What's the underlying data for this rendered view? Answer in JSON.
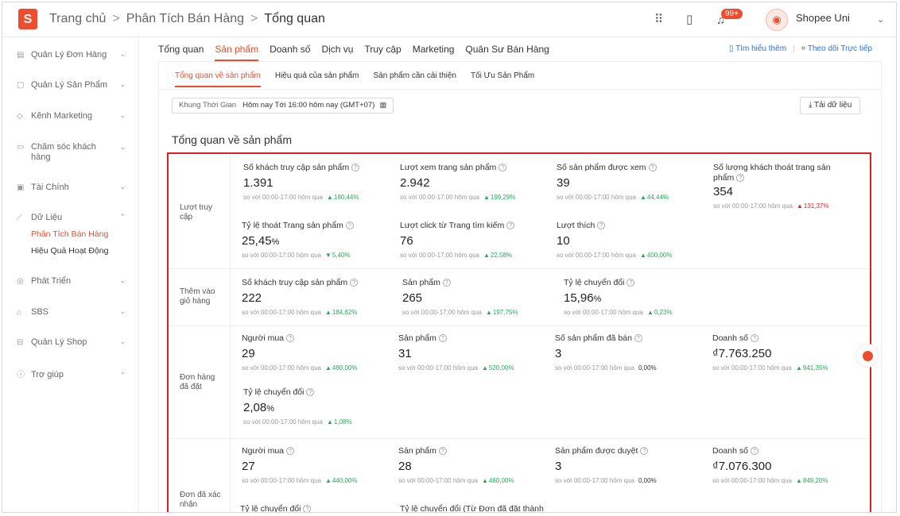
{
  "header": {
    "logo_glyph": "S",
    "breadcrumb": [
      "Trang chủ",
      "Phân Tích Bán Hàng",
      "Tổng quan"
    ],
    "breadcrumb_sep": ">",
    "notif_badge": "99+",
    "shop_name": "Shopee Uni",
    "icons": [
      "apps-grid-icon",
      "book-icon",
      "bell-icon",
      "chevron-down-icon"
    ]
  },
  "sidebar": {
    "items": [
      {
        "label": "Quản Lý Đơn Hàng",
        "icon": "order-icon"
      },
      {
        "label": "Quản Lý Sản Phẩm",
        "icon": "product-icon"
      },
      {
        "label": "Kênh Marketing",
        "icon": "tag-icon"
      },
      {
        "label": "Chăm sóc khách hàng",
        "icon": "chat-icon"
      },
      {
        "label": "Tài Chính",
        "icon": "wallet-icon"
      },
      {
        "label": "Dữ Liệu",
        "icon": "chart-icon"
      },
      {
        "label": "Phát Triển",
        "icon": "growth-icon"
      },
      {
        "label": "SBS",
        "icon": "warehouse-icon"
      },
      {
        "label": "Quản Lý Shop",
        "icon": "shop-icon"
      },
      {
        "label": "Trợ giúp",
        "icon": "help-icon"
      }
    ],
    "sub_items": [
      "Phân Tích Bán Hàng",
      "Hiệu Quả Hoạt Động"
    ]
  },
  "main_tabs": [
    "Tổng quan",
    "Sản phẩm",
    "Doanh số",
    "Dịch vụ",
    "Truy cập",
    "Marketing",
    "Quân Sư Bán Hàng"
  ],
  "top_links": {
    "learn_more": "Tìm hiểu thêm",
    "live_track": "Theo dõi Trực tiếp"
  },
  "sub_tabs": [
    "Tổng quan về sản phẩm",
    "Hiệu quả của sản phẩm",
    "Sản phẩm cần cải thiện",
    "Tối Ưu Sản Phẩm"
  ],
  "period": {
    "label": "Khung Thời Gian",
    "value": "Hôm nay  Tới 16:00 hôm nay (GMT+07)"
  },
  "download_label": "Tải dữ liệu",
  "section_title": "Tổng quan về sản phẩm",
  "compare_text": "so với 00:00-17:00 hôm qua",
  "rows": {
    "traffic": "Lượt truy cập",
    "add_to_cart": "Thêm vào giỏ hàng",
    "placed": "Đơn hàng đã đặt",
    "confirmed": "Đơn đã xác nhận"
  },
  "metrics": {
    "visitors": {
      "label": "Số khách truy cập sản phẩm",
      "value": "1.391",
      "delta": "180,44%"
    },
    "page_views": {
      "label": "Lượt xem trang sản phẩm",
      "value": "2.942",
      "delta": "199,29%"
    },
    "viewed_products": {
      "label": "Số sản phẩm được xem",
      "value": "39",
      "delta": "44,44%"
    },
    "bounce_visitors": {
      "label": "Số lượng khách thoát trang sản phẩm",
      "value": "354",
      "delta": "131,37%"
    },
    "bounce_rate": {
      "label": "Tỷ lệ thoát Trang sản phẩm",
      "value": "25,45",
      "unit": "%",
      "delta": "5,40%"
    },
    "search_clicks": {
      "label": "Lượt click từ Trang tìm kiếm",
      "value": "76",
      "delta": "22,58%"
    },
    "likes": {
      "label": "Lượt thích",
      "value": "10",
      "delta": "400,00%"
    },
    "cart_visitors": {
      "label": "Số khách truy cập sản phẩm",
      "value": "222",
      "delta": "184,62%"
    },
    "cart_products": {
      "label": "Sản phẩm",
      "value": "265",
      "delta": "197,75%"
    },
    "cart_conversion": {
      "label": "Tỷ lệ chuyển đổi",
      "value": "15,96",
      "unit": "%",
      "delta": "0,23%"
    },
    "placed_buyers": {
      "label": "Người mua",
      "value": "29",
      "delta": "480,00%"
    },
    "placed_products": {
      "label": "Sản phẩm",
      "value": "31",
      "delta": "520,00%"
    },
    "placed_units": {
      "label": "Số sản phẩm đã bán",
      "value": "3",
      "delta": "0,00%"
    },
    "placed_sales": {
      "label": "Doanh số",
      "value": "₫7.763.250",
      "delta": "941,35%"
    },
    "placed_conversion": {
      "label": "Tỷ lệ chuyển đổi",
      "value": "2,08",
      "unit": "%",
      "delta": "1,08%"
    },
    "conf_buyers": {
      "label": "Người mua",
      "value": "27",
      "delta": "440,00%"
    },
    "conf_products": {
      "label": "Sản phẩm",
      "value": "28",
      "delta": "460,00%"
    },
    "conf_approved": {
      "label": "Sản phẩm được duyệt",
      "value": "3",
      "delta": "0,00%"
    },
    "conf_sales": {
      "label": "Doanh số",
      "value": "₫7.076.300",
      "delta": "849,20%"
    },
    "conf_conversion": {
      "label": "Tỷ lệ chuyển đổi"
    },
    "conf_conversion_from_placed": {
      "label": "Tỷ lệ chuyển đổi (Từ Đơn đã đặt thành"
    }
  },
  "colors": {
    "brand": "#ee4d2d",
    "up": "#26aa5a",
    "down": "#e02020",
    "highlight": "#e02020",
    "link": "#2673dd"
  }
}
